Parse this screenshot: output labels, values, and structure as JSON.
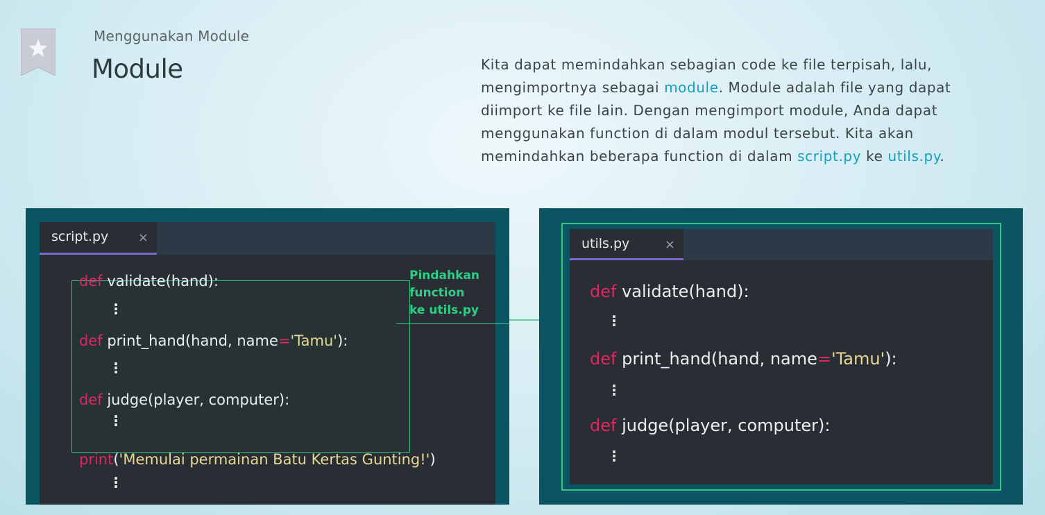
{
  "header": {
    "breadcrumb": "Menggunakan Module",
    "title": "Module"
  },
  "description": {
    "part1": "Kita dapat memindahkan sebagian code ke file terpisah, lalu, mengimportnya sebagai ",
    "link_module": "module",
    "part2": ". Module adalah file yang dapat diimport ke file lain. Dengan mengimport module, Anda dapat menggunakan function di dalam modul tersebut. Kita akan memindahkan beberapa function di dalam ",
    "link_script": "script.py",
    "part3": " ke ",
    "link_utils": "utils.py",
    "part4": "."
  },
  "left_editor": {
    "tab_label": "script.py",
    "close_icon": "×",
    "annotation": [
      "Pindahkan",
      "function",
      "ke utils.py"
    ],
    "lines": {
      "validate": {
        "kw": "def",
        "rest": " validate(hand):"
      },
      "print_hand": {
        "kw": "def",
        "pre": " print_hand(hand, name",
        "op": "=",
        "str": "'Tamu'",
        "post": "):"
      },
      "judge": {
        "kw": "def",
        "rest": " judge(player, computer):"
      },
      "print_call": {
        "kw": "print",
        "pre": "(",
        "str": "'Memulai permainan Batu Kertas Gunting!'",
        "post": ")"
      }
    }
  },
  "right_editor": {
    "tab_label": "utils.py",
    "close_icon": "×",
    "lines": {
      "validate": {
        "kw": "def",
        "rest": " validate(hand):"
      },
      "print_hand": {
        "kw": "def",
        "pre": " print_hand(hand, name",
        "op": "=",
        "str": "'Tamu'",
        "post": "):"
      },
      "judge": {
        "kw": "def",
        "rest": " judge(player, computer):"
      }
    }
  },
  "colors": {
    "panel_bg": "#0b5562",
    "editor_bg": "#292d34",
    "tab_underline": "#7c6ad0",
    "keyword": "#e0265e",
    "string": "#e9d894",
    "highlight_green": "#33c47f",
    "link": "#14a0bf"
  },
  "icons": {
    "bookmark": "bookmark-star-icon",
    "close": "close-icon",
    "ellipsis": "vertical-ellipsis-icon",
    "arrow": "arrow-right-icon"
  }
}
